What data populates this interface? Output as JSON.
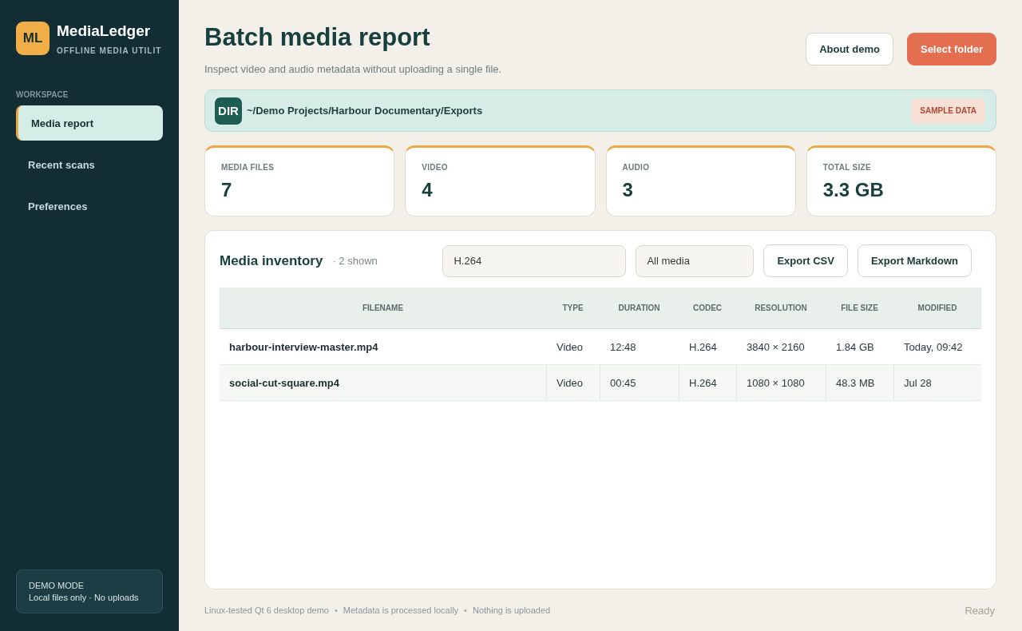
{
  "sidebar": {
    "logo": "ML",
    "app_name": "MediaLedger",
    "tagline": "OFFLINE MEDIA UTILIT",
    "section_label": "WORKSPACE",
    "items": [
      {
        "label": "Media report",
        "selected": true
      },
      {
        "label": "Recent scans",
        "selected": false
      },
      {
        "label": "Preferences",
        "selected": false
      }
    ],
    "mode_box": {
      "title": "DEMO MODE",
      "text": "Local files only · No uploads"
    }
  },
  "header": {
    "title": "Batch media report",
    "subtitle": "Inspect video and audio metadata without uploading a single file.",
    "buttons": [
      {
        "label": "About demo",
        "kind": "secondary"
      },
      {
        "label": "Select folder",
        "kind": "primary"
      }
    ]
  },
  "path_bar": {
    "badge": "DIR",
    "path": "~/Demo Projects/Harbour Documentary/Exports",
    "tag": "SAMPLE DATA"
  },
  "stats": [
    {
      "label": "MEDIA FILES",
      "value": "7"
    },
    {
      "label": "VIDEO",
      "value": "4"
    },
    {
      "label": "AUDIO",
      "value": "3"
    },
    {
      "label": "TOTAL SIZE",
      "value": "3.3 GB"
    }
  ],
  "inventory": {
    "title": "Media inventory",
    "count": "· 2 shown",
    "search": {
      "value": "H.264"
    },
    "filter": {
      "value": "All media"
    },
    "buttons": [
      "Export CSV",
      "Export Markdown"
    ],
    "table": {
      "columns": [
        "FILENAME",
        "TYPE",
        "DURATION",
        "CODEC",
        "RESOLUTION",
        "FILE SIZE",
        "MODIFIED"
      ],
      "rows": [
        [
          "harbour-interview-master.mp4",
          "Video",
          "12:48",
          "H.264",
          "3840 × 2160",
          "1.84 GB",
          "Today, 09:42"
        ],
        [
          "social-cut-square.mp4",
          "Video",
          "00:45",
          "H.264",
          "1080 × 1080",
          "48.3 MB",
          "Jul 28"
        ]
      ]
    }
  },
  "footer": {
    "items": [
      "Linux-tested Qt 6 desktop demo",
      "Metadata is processed locally",
      "Nothing is uploaded"
    ],
    "separator": "•",
    "status": "Ready"
  }
}
